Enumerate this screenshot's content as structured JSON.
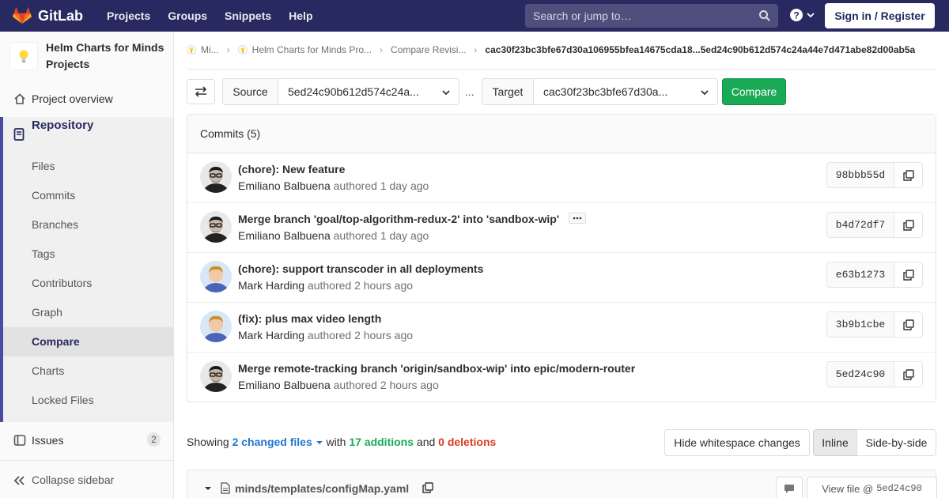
{
  "topbar": {
    "brand": "GitLab",
    "nav": [
      "Projects",
      "Groups",
      "Snippets",
      "Help"
    ],
    "search_placeholder": "Search or jump to…",
    "signin": "Sign in / Register"
  },
  "sidebar": {
    "project_name": "Helm Charts for Minds Projects",
    "overview": "Project overview",
    "repository": "Repository",
    "sub_items": [
      "Files",
      "Commits",
      "Branches",
      "Tags",
      "Contributors",
      "Graph",
      "Compare",
      "Charts",
      "Locked Files"
    ],
    "active_sub": "Compare",
    "issues": "Issues",
    "issues_count": "2",
    "collapse": "Collapse sidebar"
  },
  "breadcrumbs": {
    "items": [
      "Mi...",
      "Helm Charts for Minds Pro...",
      "Compare Revisi..."
    ],
    "current": "cac30f23bc3bfe67d30a106955bfea14675cda18...5ed24c90b612d574c24a44e7d471abe82d00ab5a"
  },
  "compare": {
    "source_label": "Source",
    "source_value": "5ed24c90b612d574c24a...",
    "ellipsis": "...",
    "target_label": "Target",
    "target_value": "cac30f23bc3bfe67d30a...",
    "button": "Compare"
  },
  "commits": {
    "header": "Commits (5)",
    "authored": "authored",
    "list": [
      {
        "title": "(chore): New feature",
        "author": "Emiliano Balbuena",
        "time": "1 day ago",
        "sha": "98bbb55d",
        "avatar": "emiliano",
        "has_more": false
      },
      {
        "title": "Merge branch 'goal/top-algorithm-redux-2' into 'sandbox-wip'",
        "author": "Emiliano Balbuena",
        "time": "1 day ago",
        "sha": "b4d72df7",
        "avatar": "emiliano",
        "has_more": true
      },
      {
        "title": "(chore): support transcoder in all deployments",
        "author": "Mark Harding",
        "time": "2 hours ago",
        "sha": "e63b1273",
        "avatar": "mark",
        "has_more": false
      },
      {
        "title": "(fix): plus max video length",
        "author": "Mark Harding",
        "time": "2 hours ago",
        "sha": "3b9b1cbe",
        "avatar": "mark",
        "has_more": false
      },
      {
        "title": "Merge remote-tracking branch 'origin/sandbox-wip' into epic/modern-router",
        "author": "Emiliano Balbuena",
        "time": "2 hours ago",
        "sha": "5ed24c90",
        "avatar": "emiliano",
        "has_more": false
      }
    ]
  },
  "summary": {
    "showing": "Showing",
    "changed": "2 changed files",
    "with": "with",
    "additions": "17 additions",
    "and": "and",
    "deletions": "0 deletions"
  },
  "view_controls": {
    "hide_ws": "Hide whitespace changes",
    "inline": "Inline",
    "side_by_side": "Side-by-side"
  },
  "file": {
    "path": "minds/templates/configMap.yaml",
    "view_file": "View file @",
    "view_sha": "5ed24c90"
  },
  "colors": {
    "nav": "#292961",
    "accent": "#4b4ba3",
    "green": "#1aaa55",
    "red": "#db3b21",
    "link": "#1f78d1"
  }
}
